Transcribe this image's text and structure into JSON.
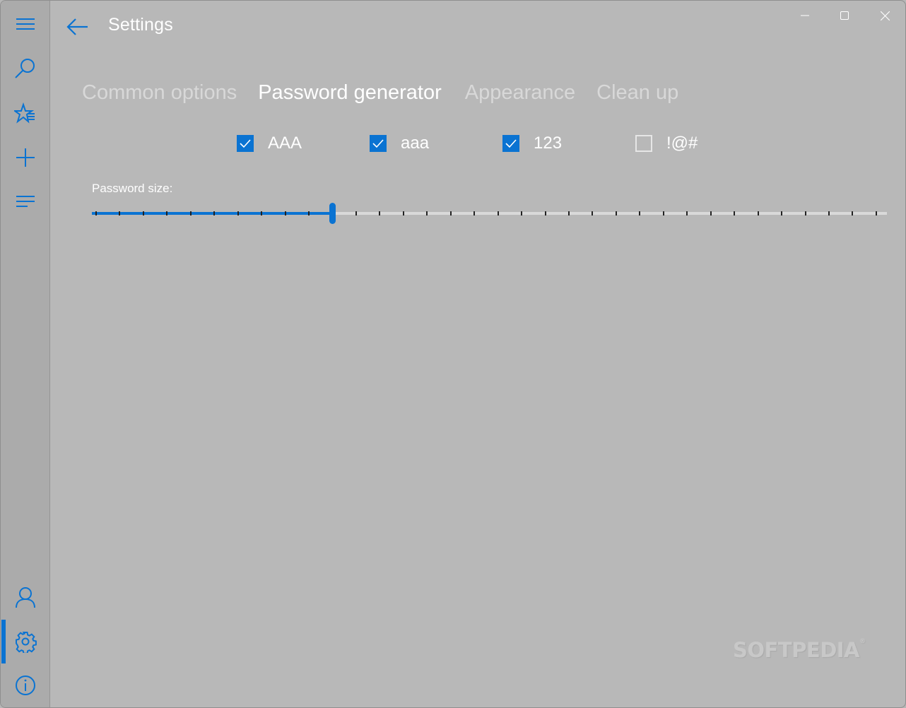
{
  "window": {
    "title": "Settings",
    "controls": {
      "minimize": "minimize",
      "maximize": "maximize",
      "close": "close"
    }
  },
  "sidebar": {
    "items": [
      {
        "id": "menu",
        "icon": "hamburger-menu-icon"
      },
      {
        "id": "search",
        "icon": "search-icon"
      },
      {
        "id": "favorites",
        "icon": "star-list-icon"
      },
      {
        "id": "add",
        "icon": "plus-icon"
      },
      {
        "id": "list",
        "icon": "list-icon"
      },
      {
        "id": "account",
        "icon": "user-icon"
      },
      {
        "id": "settings",
        "icon": "gear-icon",
        "active": true
      },
      {
        "id": "about",
        "icon": "info-icon"
      }
    ],
    "accent_color": "#0a73d2"
  },
  "header": {
    "back_icon": "back-arrow-icon",
    "title": "Settings"
  },
  "tabs": [
    {
      "label": "Common options",
      "active": false
    },
    {
      "label": "Password generator",
      "active": true
    },
    {
      "label": "Appearance",
      "active": false
    },
    {
      "label": "Clean up",
      "active": false
    }
  ],
  "password_generator": {
    "options": [
      {
        "label": "AAA",
        "checked": true
      },
      {
        "label": "aaa",
        "checked": true
      },
      {
        "label": "123",
        "checked": true
      },
      {
        "label": "!@#",
        "checked": false
      }
    ],
    "size_label": "Password size:",
    "size_slider": {
      "fraction": 0.302,
      "tick_count": 34
    }
  },
  "watermark": {
    "text": "SOFTPEDIA",
    "mark": "®"
  }
}
